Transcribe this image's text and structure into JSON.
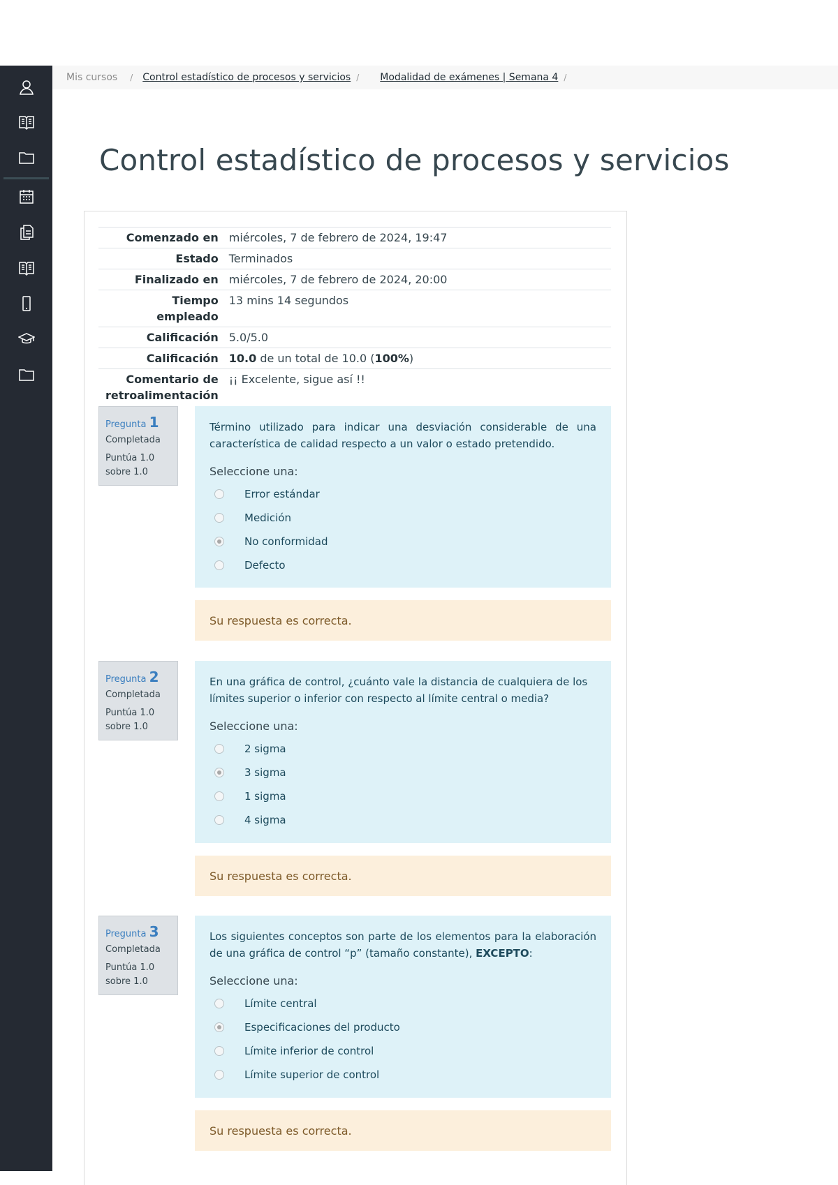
{
  "sidebar": {
    "icons": [
      "user-icon",
      "book-icon",
      "folder-icon",
      "calendar-icon",
      "files-icon",
      "book-icon",
      "mobile-icon",
      "graduation-cap-icon",
      "folder-icon"
    ]
  },
  "breadcrumb": {
    "items": [
      "Mis cursos",
      "Control estadístico de procesos y servicios",
      "Modalidad de exámenes | Semana 4"
    ],
    "separator": "/"
  },
  "page": {
    "title": "Control estadístico de procesos y servicios"
  },
  "summary": {
    "started_label": "Comenzado en",
    "started_value": "miércoles, 7 de febrero de 2024, 19:47",
    "state_label": "Estado",
    "state_value": "Terminados",
    "finished_label": "Finalizado en",
    "finished_value": "miércoles, 7 de febrero de 2024, 20:00",
    "time_label": "Tiempo empleado",
    "time_value": "13 mins 14 segundos",
    "marks_label": "Calificación",
    "marks_value": "5.0/5.0",
    "grade_label": "Calificación",
    "grade_score": "10.0",
    "grade_middle": " de un total de 10.0 (",
    "grade_percent": "100%",
    "grade_end": ")",
    "feedback_label": "Comentario de retroalimentación",
    "feedback_value": "¡¡ Excelente, sigue así !!"
  },
  "questions": [
    {
      "label": "Pregunta",
      "number": "1",
      "state": "Completada",
      "grade": "Puntúa 1.0 sobre 1.0",
      "text": "Término utilizado para indicar una desviación considerable de una característica de calidad respecto a un valor o estado pretendido.",
      "prompt": "Seleccione una:",
      "options": [
        "Error estándar",
        "Medición",
        "No conformidad",
        "Defecto"
      ],
      "selected": 2,
      "feedback": "Su respuesta es correcta."
    },
    {
      "label": "Pregunta",
      "number": "2",
      "state": "Completada",
      "grade": "Puntúa 1.0 sobre 1.0",
      "text": "En una gráfica de control, ¿cuánto vale la distancia de cualquiera de los límites superior o inferior con respecto al límite central o media?",
      "prompt": "Seleccione una:",
      "options": [
        "2 sigma",
        "3 sigma",
        "1 sigma",
        "4 sigma"
      ],
      "selected": 1,
      "feedback": "Su respuesta es correcta."
    },
    {
      "label": "Pregunta",
      "number": "3",
      "state": "Completada",
      "grade": "Puntúa 1.0 sobre 1.0",
      "text_before": "Los siguientes conceptos son parte de los elementos para la elaboración de una gráfica de control “p” (tamaño constante), ",
      "text_bold": "EXCEPTO",
      "text_after": ":",
      "prompt": "Seleccione una:",
      "options": [
        "Límite central",
        "Especificaciones del producto",
        "Límite inferior de control",
        "Límite superior de control"
      ],
      "selected": 1,
      "feedback": "Su respuesta es correcta."
    }
  ]
}
